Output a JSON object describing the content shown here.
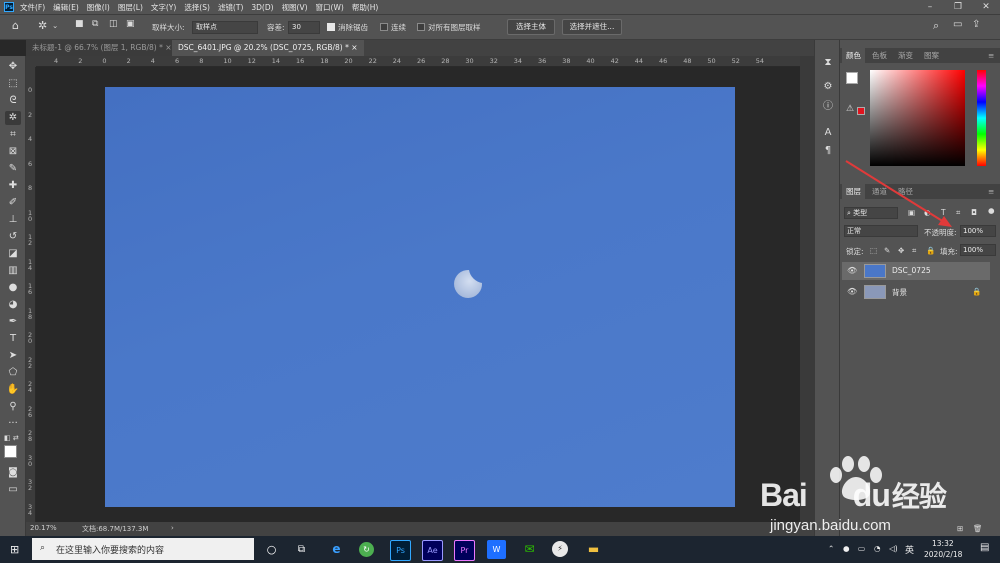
{
  "menu": {
    "items": [
      "文件(F)",
      "编辑(E)",
      "图像(I)",
      "图层(L)",
      "文字(Y)",
      "选择(S)",
      "滤镜(T)",
      "3D(D)",
      "视图(V)",
      "窗口(W)",
      "帮助(H)"
    ],
    "logo": "Ps"
  },
  "options": {
    "sample_size_label": "取样大小:",
    "sample_size_value": "取样点",
    "tolerance_label": "容差:",
    "tolerance_value": "30",
    "antialias_label": "消除锯齿",
    "contiguous_label": "连续",
    "all_layers_label": "对所有图层取样",
    "select_subject_label": "选择主体",
    "select_mask_label": "选择并遮住..."
  },
  "tabs": [
    {
      "label": "未标题-1 @ 66.7% (图层 1, RGB/8) *"
    },
    {
      "label": "DSC_6401.JPG @ 20.2% (DSC_0725, RGB/8) *"
    }
  ],
  "rulers": {
    "h": [
      "4",
      "2",
      "0",
      "2",
      "4",
      "6",
      "8",
      "10",
      "12",
      "14",
      "16",
      "18",
      "20",
      "22",
      "24",
      "26",
      "28",
      "30",
      "32",
      "34",
      "36",
      "38",
      "40",
      "42",
      "44",
      "46",
      "48",
      "50",
      "52",
      "54"
    ],
    "v": [
      "0",
      "2",
      "4",
      "6",
      "8",
      "1 0",
      "1 2",
      "1 4",
      "1 6",
      "1 8",
      "2 0",
      "2 2",
      "2 4",
      "2 6",
      "2 8",
      "3 0",
      "3 2",
      "3 4"
    ]
  },
  "status": {
    "zoom": "20.17%",
    "doc": "文档:68.7M/137.3M"
  },
  "color_panel": {
    "tabs": [
      "颜色",
      "色板",
      "渐变",
      "图案"
    ],
    "fg_color": "#ffffff",
    "bg_color": "#e0141e"
  },
  "layers_panel": {
    "tabs": [
      "图层",
      "通道",
      "路径"
    ],
    "filter_label": "类型",
    "blend_mode": "正常",
    "opacity_label": "不透明度:",
    "opacity_value": "100%",
    "lock_label": "锁定:",
    "fill_label": "填充:",
    "fill_value": "100%",
    "layers": [
      {
        "name": "DSC_0725",
        "selected": true
      },
      {
        "name": "背景",
        "selected": false
      }
    ]
  },
  "taskbar": {
    "search_placeholder": "在这里输入你要搜索的内容",
    "ime": "英",
    "time": "13:32",
    "date": "2020/2/18",
    "apps": [
      "Ps",
      "Ae",
      "Pr",
      "W"
    ]
  },
  "watermark": {
    "brand": "Bai",
    "brand2": "du",
    "suffix": "经验",
    "url": "jingyan.baidu.com"
  }
}
